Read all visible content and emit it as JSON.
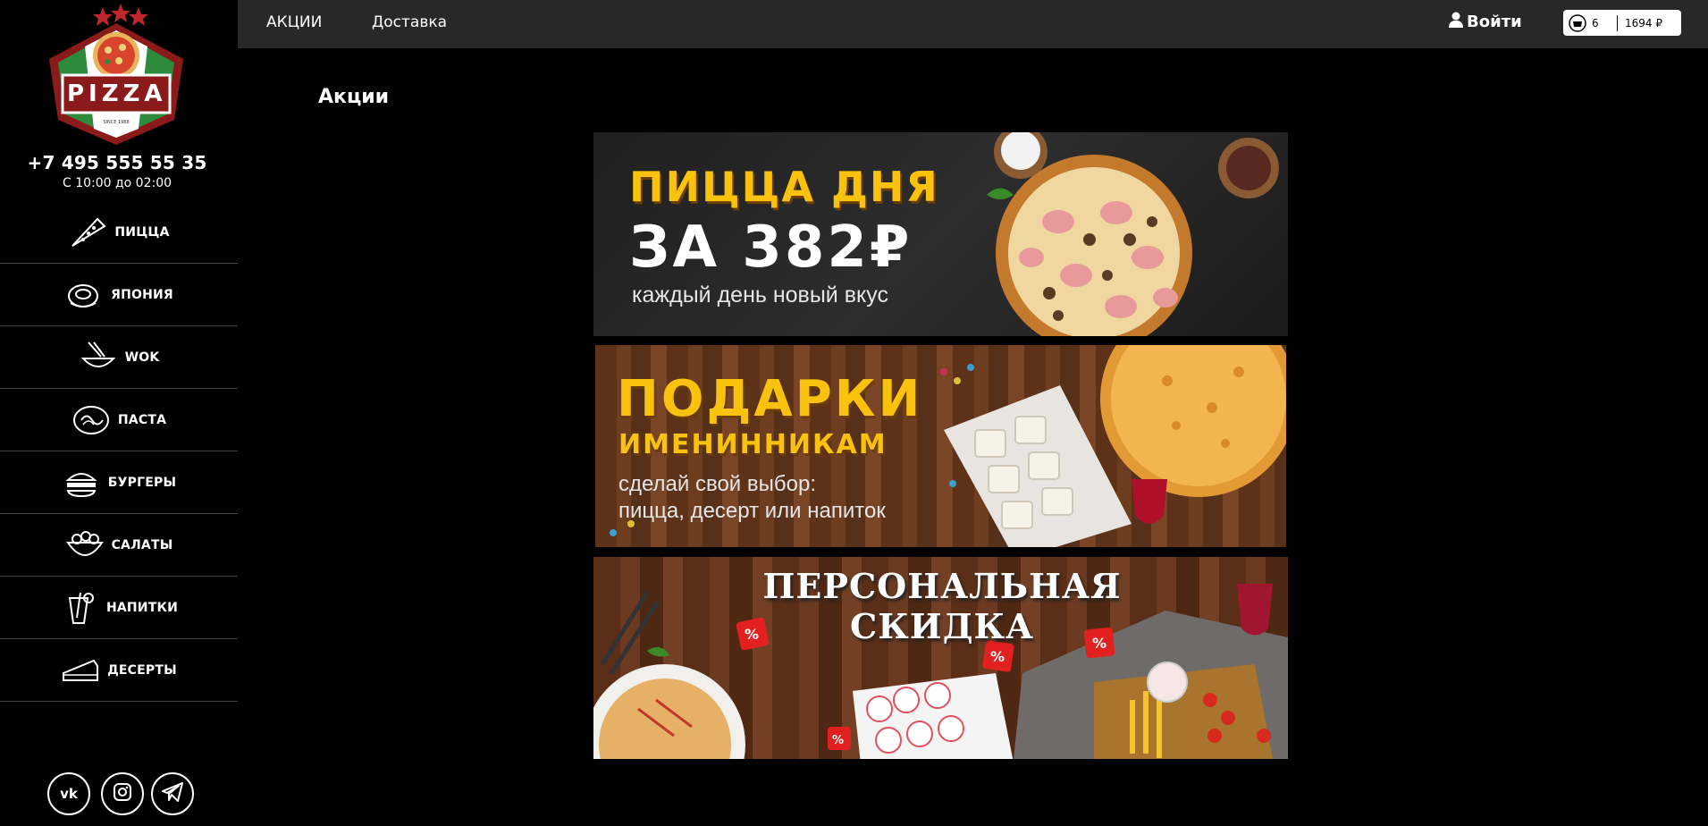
{
  "brand": {
    "logo_text": "PIZZA",
    "logo_small": "SINCE 1988"
  },
  "contact": {
    "phone": "+7 495 555 55 35",
    "hours": "С 10:00 до 02:00"
  },
  "sidebar": {
    "items": [
      {
        "label": "ПИЦЦА",
        "icon": "pizza-slice-icon"
      },
      {
        "label": "ЯПОНИЯ",
        "icon": "sushi-roll-icon"
      },
      {
        "label": "WOK",
        "icon": "wok-noodles-icon"
      },
      {
        "label": "ПАСТА",
        "icon": "pasta-plate-icon"
      },
      {
        "label": "БУРГЕРЫ",
        "icon": "burger-icon"
      },
      {
        "label": "САЛАТЫ",
        "icon": "salad-bowl-icon"
      },
      {
        "label": "НАПИТКИ",
        "icon": "drink-glass-icon"
      },
      {
        "label": "ДЕСЕРТЫ",
        "icon": "cake-slice-icon"
      }
    ]
  },
  "social": [
    "vk-icon",
    "instagram-icon",
    "telegram-icon"
  ],
  "header": {
    "nav": [
      "АКЦИИ",
      "Доставка"
    ],
    "login_label": "Войти",
    "cart": {
      "count": "6",
      "total": "1694 ₽"
    }
  },
  "main": {
    "title": "Акции",
    "banners": [
      {
        "line1": "ПИЦЦА ДНЯ",
        "line2": "ЗА 382₽",
        "line3": "каждый день новый вкус"
      },
      {
        "line1": "ПОДАРКИ",
        "line2": "ИМЕНИННИКАМ",
        "line3": "сделай свой выбор:",
        "line4": "пицца, десерт или напиток"
      },
      {
        "line1": "ПЕРСОНАЛЬНАЯ СКИДКА"
      }
    ]
  },
  "colors": {
    "accent_red": "#8b1a1a",
    "banner_yellow": "#f8c20e",
    "topbar": "#282828"
  }
}
